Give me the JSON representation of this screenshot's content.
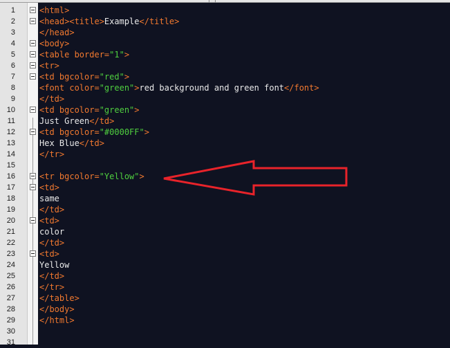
{
  "editor": {
    "lines": [
      {
        "num": "1",
        "fold": true,
        "parts": [
          {
            "t": "<html>",
            "k": "tag"
          }
        ]
      },
      {
        "num": "2",
        "fold": true,
        "parts": [
          {
            "t": "<head><title>",
            "k": "tag"
          },
          {
            "t": "Example",
            "k": "txt"
          },
          {
            "t": "</title>",
            "k": "tag"
          }
        ]
      },
      {
        "num": "3",
        "fold": false,
        "parts": [
          {
            "t": "</head>",
            "k": "tag"
          }
        ]
      },
      {
        "num": "4",
        "fold": true,
        "parts": [
          {
            "t": "<body>",
            "k": "tag"
          }
        ]
      },
      {
        "num": "5",
        "fold": true,
        "parts": [
          {
            "t": "<table border=",
            "k": "tag"
          },
          {
            "t": "\"1\"",
            "k": "val"
          },
          {
            "t": ">",
            "k": "tag"
          }
        ]
      },
      {
        "num": "6",
        "fold": true,
        "parts": [
          {
            "t": "<tr>",
            "k": "tag"
          }
        ]
      },
      {
        "num": "7",
        "fold": true,
        "parts": [
          {
            "t": "<td bgcolor=",
            "k": "tag"
          },
          {
            "t": "\"red\"",
            "k": "val"
          },
          {
            "t": ">",
            "k": "tag"
          }
        ]
      },
      {
        "num": "8",
        "fold": false,
        "parts": [
          {
            "t": "<font color=",
            "k": "tag"
          },
          {
            "t": "\"green\"",
            "k": "val"
          },
          {
            "t": ">",
            "k": "tag"
          },
          {
            "t": "red background and green font",
            "k": "txt"
          },
          {
            "t": "</font>",
            "k": "tag"
          }
        ]
      },
      {
        "num": "9",
        "fold": false,
        "parts": [
          {
            "t": "</td>",
            "k": "tag"
          }
        ]
      },
      {
        "num": "10",
        "fold": true,
        "parts": [
          {
            "t": "<td bgcolor=",
            "k": "tag"
          },
          {
            "t": "\"green\"",
            "k": "val"
          },
          {
            "t": ">",
            "k": "tag"
          }
        ]
      },
      {
        "num": "11",
        "fold": false,
        "parts": [
          {
            "t": "Just Green",
            "k": "txt"
          },
          {
            "t": "</td>",
            "k": "tag"
          }
        ]
      },
      {
        "num": "12",
        "fold": true,
        "parts": [
          {
            "t": "<td bgcolor=",
            "k": "tag"
          },
          {
            "t": "\"#0000FF\"",
            "k": "val"
          },
          {
            "t": ">",
            "k": "tag"
          }
        ]
      },
      {
        "num": "13",
        "fold": false,
        "parts": [
          {
            "t": "Hex Blue",
            "k": "txt"
          },
          {
            "t": "</td>",
            "k": "tag"
          }
        ]
      },
      {
        "num": "14",
        "fold": false,
        "parts": [
          {
            "t": "</tr>",
            "k": "tag"
          }
        ]
      },
      {
        "num": "15",
        "fold": false,
        "parts": []
      },
      {
        "num": "16",
        "fold": true,
        "parts": [
          {
            "t": "<tr bgcolor=",
            "k": "tag"
          },
          {
            "t": "\"Yellow\"",
            "k": "val"
          },
          {
            "t": ">",
            "k": "tag"
          }
        ]
      },
      {
        "num": "17",
        "fold": true,
        "parts": [
          {
            "t": "<td>",
            "k": "tag"
          }
        ]
      },
      {
        "num": "18",
        "fold": false,
        "parts": [
          {
            "t": "same",
            "k": "txt"
          }
        ]
      },
      {
        "num": "19",
        "fold": false,
        "parts": [
          {
            "t": "</td>",
            "k": "tag"
          }
        ]
      },
      {
        "num": "20",
        "fold": true,
        "parts": [
          {
            "t": "<td>",
            "k": "tag"
          }
        ]
      },
      {
        "num": "21",
        "fold": false,
        "parts": [
          {
            "t": "color",
            "k": "txt"
          }
        ]
      },
      {
        "num": "22",
        "fold": false,
        "parts": [
          {
            "t": "</td>",
            "k": "tag"
          }
        ]
      },
      {
        "num": "23",
        "fold": true,
        "parts": [
          {
            "t": "<td>",
            "k": "tag"
          }
        ]
      },
      {
        "num": "24",
        "fold": false,
        "parts": [
          {
            "t": "Yellow",
            "k": "txt"
          }
        ]
      },
      {
        "num": "25",
        "fold": false,
        "parts": [
          {
            "t": "</td>",
            "k": "tag"
          }
        ]
      },
      {
        "num": "26",
        "fold": false,
        "parts": [
          {
            "t": "</tr>",
            "k": "tag"
          }
        ]
      },
      {
        "num": "27",
        "fold": false,
        "parts": [
          {
            "t": "</table>",
            "k": "tag"
          }
        ]
      },
      {
        "num": "28",
        "fold": false,
        "parts": [
          {
            "t": "</body>",
            "k": "tag"
          }
        ]
      },
      {
        "num": "29",
        "fold": false,
        "parts": [
          {
            "t": "</html>",
            "k": "tag"
          }
        ]
      },
      {
        "num": "30",
        "fold": false,
        "parts": []
      },
      {
        "num": "31",
        "fold": false,
        "parts": []
      }
    ]
  },
  "colors": {
    "background": "#0f1221",
    "tag": "#f2792f",
    "attribute_value": "#4fcf3f",
    "text": "#eaeaea",
    "annotation_arrow": "#e8232a"
  },
  "annotation": {
    "shape": "arrow",
    "points_to_line": "16"
  }
}
